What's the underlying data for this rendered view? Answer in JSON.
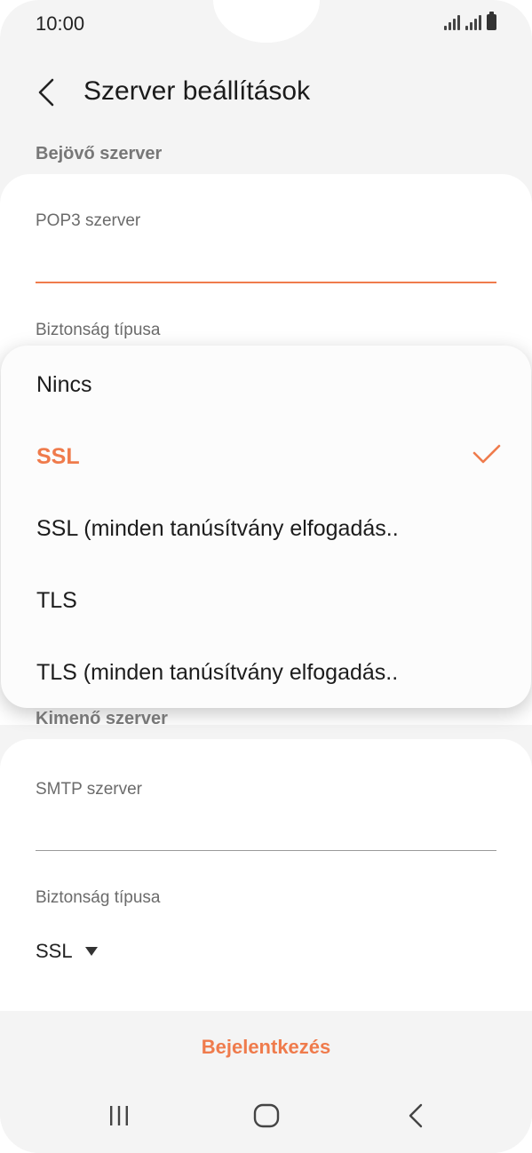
{
  "status_bar": {
    "time": "10:00"
  },
  "header": {
    "title": "Szerver beállítások"
  },
  "incoming": {
    "section_label": "Bejövő szerver",
    "server_label": "POP3 szerver",
    "server_value": "",
    "security_label": "Biztonság típusa"
  },
  "dropdown": {
    "options": [
      {
        "label": "Nincs",
        "selected": false
      },
      {
        "label": "SSL",
        "selected": true
      },
      {
        "label": "SSL (minden tanúsítvány elfogadás..",
        "selected": false
      },
      {
        "label": "TLS",
        "selected": false
      },
      {
        "label": "TLS (minden tanúsítvány elfogadás..",
        "selected": false
      }
    ]
  },
  "outgoing": {
    "section_label": "Kimenő szerver",
    "server_label": "SMTP szerver",
    "server_value": "",
    "security_label": "Biztonság típusa",
    "security_value": "SSL"
  },
  "actions": {
    "login_label": "Bejelentkezés"
  },
  "colors": {
    "accent": "#ef7b4c",
    "background": "#f4f4f4",
    "card": "#ffffff"
  },
  "icons": {
    "back": "chevron-left-icon",
    "check": "check-icon",
    "recents": "recents-icon",
    "home": "home-icon",
    "nav_back": "nav-back-icon"
  }
}
